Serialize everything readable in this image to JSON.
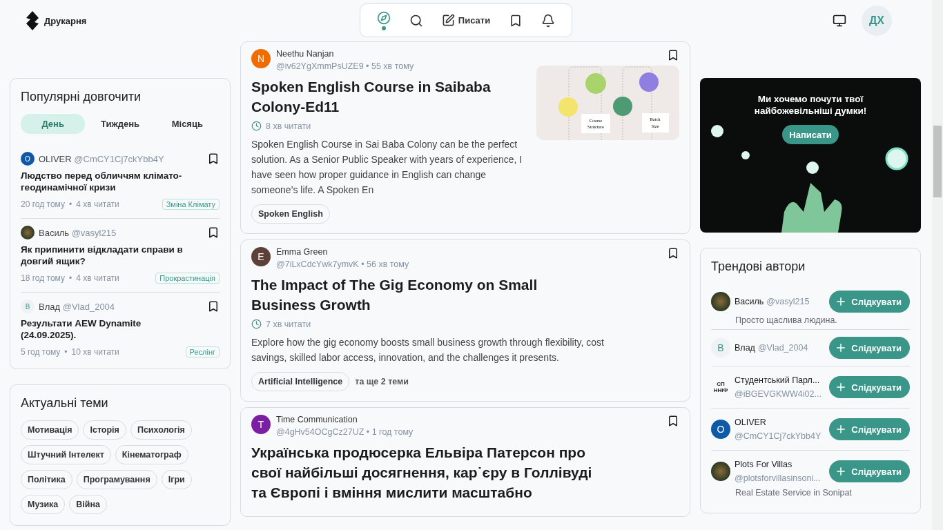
{
  "header": {
    "logo_text": "Друкарня",
    "nav": [
      {
        "selected": true
      },
      {
        "selected": false
      },
      {
        "label": "Писати",
        "selected": false
      },
      {
        "selected": false
      },
      {
        "selected": false
      }
    ],
    "avatar_initials": "ДХ"
  },
  "popular": {
    "title": "Популярні довгочити",
    "tabs": [
      {
        "label": "День",
        "selected": true
      },
      {
        "label": "Тиждень",
        "selected": false
      },
      {
        "label": "Місяць",
        "selected": false
      }
    ],
    "posts": [
      {
        "avatar": {
          "kind": "letter",
          "letter": "O",
          "color": "#0f5aa6"
        },
        "name": "OLIVER",
        "handle": "@CmCY1Cj7ckYbb4Y",
        "title": "Людство перед обличчям клімато-геодинамічної кризи",
        "time": "20 год тому",
        "read": "4 хв читати",
        "tag": "Зміна Клімату",
        "dot": "•"
      },
      {
        "avatar": {
          "kind": "photo"
        },
        "name": "Василь",
        "handle": "@vasyl215",
        "title": "Як припинити відкладати справи в довгий ящик?",
        "time": "18 год тому",
        "read": "4 хв читати",
        "tag": "Прокрастинація",
        "dot": "•"
      },
      {
        "avatar": {
          "kind": "letter",
          "letter": "В",
          "color": "#eef2f5"
        },
        "name": "Влад",
        "handle": "@Vlad_2004",
        "title": "Результати AEW Dynamite (24.09.2025).",
        "time": "5 год тому",
        "read": "10 хв читати",
        "tag": "Реслінг",
        "dot": "•"
      }
    ]
  },
  "topics": {
    "title": "Актуальні теми",
    "tags": [
      "Мотивація",
      "Історія",
      "Психологія",
      "Штучний Інтелект",
      "Кінематограф",
      "Політика",
      "Програмування",
      "Ігри",
      "Музика",
      "Війна"
    ]
  },
  "feed": [
    {
      "avatar": {
        "kind": "letter",
        "letter": "N",
        "color": "#ef6c00"
      },
      "name": "Neethu Nanjan",
      "handle": "@iv62YgXmmPsUZE9",
      "time": "55 хв тому",
      "dot": "•",
      "title": "Spoken English Course in Saibaba Colony-Ed11",
      "read": "8 хв читати",
      "excerpt": "Spoken English Course in Sai Baba Colony can be the perfect solution. As a Senior Public Speaker with years of experience, I have seen how proper guidance in English can change someone’s life. A Spoken En",
      "thumbnail": {
        "labels": [
          "Course Structure",
          "Batch Size"
        ]
      },
      "tags": [
        "Spoken English"
      ]
    },
    {
      "avatar": {
        "kind": "letter",
        "letter": "E",
        "color": "#5d4037"
      },
      "name": "Emma Green",
      "handle": "@7iLxCdcYwk7ymvK",
      "time": "56 хв тому",
      "dot": "•",
      "title": "The Impact of The Gig Economy on Small Business Growth",
      "read": "7 хв читати",
      "excerpt": "Explore how the gig economy boosts small business growth through flexibility, cost savings, skilled labor access, innovation, and the challenges it presents.",
      "tags": [
        "Artificial Intelligence"
      ],
      "more_topics": "та ще 2 теми"
    },
    {
      "avatar": {
        "kind": "letter",
        "letter": "T",
        "color": "#7b1fa2"
      },
      "name": "Time Communication",
      "handle": "@4gHv54OCgCz27UZ",
      "time": "1 год тому",
      "dot": "•",
      "title": "Українська продюсерка Ельвіра Патерсон про свої найбільші досягнення, кар˙єру в Голлівуді та Європі і вміння мислити масштабно"
    }
  ],
  "promo": {
    "text": "Ми хочемо почути твої найбожевільніші думки!",
    "button": "Написати"
  },
  "authors": {
    "title": "Трендові автори",
    "items": [
      {
        "avatar": {
          "kind": "photo"
        },
        "name": "Василь",
        "handle": "@vasyl215",
        "bio": "Просто щаслива людина.",
        "follow": "Слідкувати"
      },
      {
        "avatar": {
          "kind": "letter",
          "letter": "В",
          "color": "#eef2f5"
        },
        "name": "Влад",
        "handle": "@Vlad_2004",
        "follow": "Слідкувати"
      },
      {
        "avatar": {
          "kind": "logo",
          "text": "СП ННІФ"
        },
        "name": "Студентський Парл...",
        "handle": "@iBGEVGKWW4i02...",
        "follow": "Слідкувати"
      },
      {
        "avatar": {
          "kind": "letter",
          "letter": "O",
          "color": "#0f5aa6"
        },
        "name": "OLIVER",
        "handle": "@CmCY1Cj7ckYbb4Y",
        "follow": "Слідкувати"
      },
      {
        "avatar": {
          "kind": "photo"
        },
        "name": "Plots For Villas",
        "handle": "@plotsforvillasinsoni...",
        "bio": "Real Estate Service in Sonipat",
        "follow": "Слідкувати"
      }
    ]
  }
}
